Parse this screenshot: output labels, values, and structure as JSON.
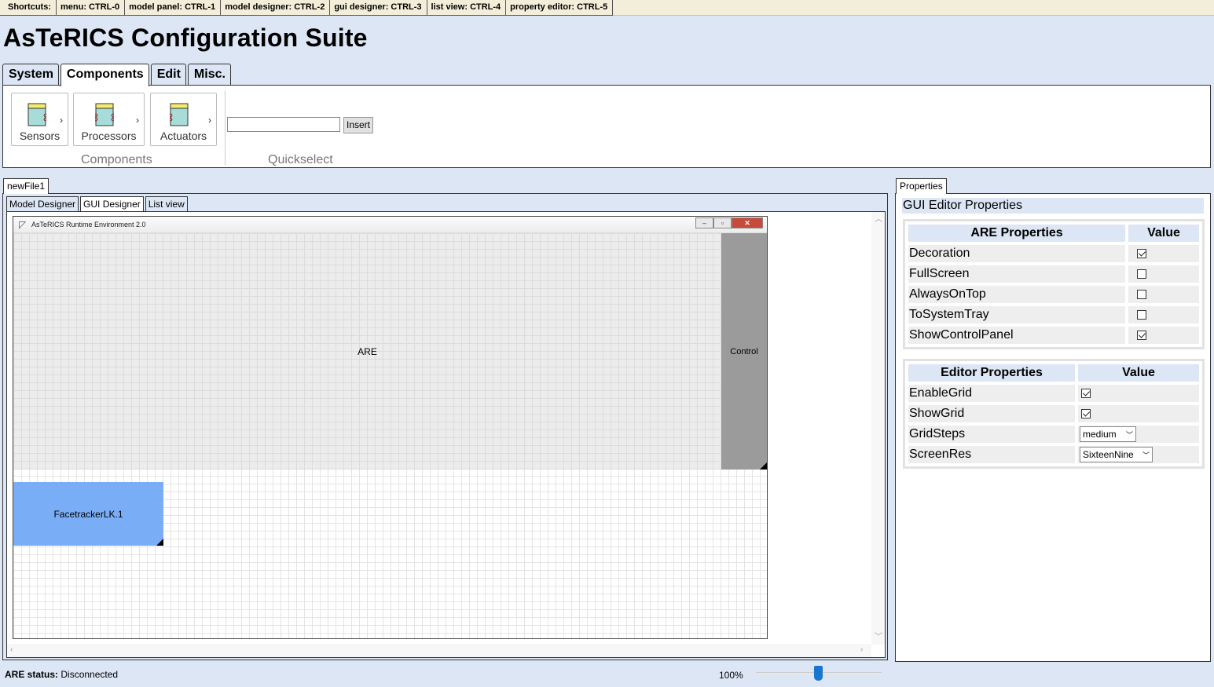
{
  "shortcuts": {
    "label": "Shortcuts:",
    "items": [
      "menu: CTRL-0",
      "model panel: CTRL-1",
      "model designer: CTRL-2",
      "gui designer: CTRL-3",
      "list view: CTRL-4",
      "property editor: CTRL-5"
    ]
  },
  "app": {
    "title": "AsTeRICS Configuration Suite"
  },
  "main_tabs": [
    "System",
    "Components",
    "Edit",
    "Misc."
  ],
  "ribbon": {
    "buttons": [
      {
        "label": "Sensors",
        "icon": "sensor-icon"
      },
      {
        "label": "Processors",
        "icon": "processor-icon"
      },
      {
        "label": "Actuators",
        "icon": "actuator-icon"
      }
    ],
    "components_group": "Components",
    "quickselect_group": "Quickselect",
    "quickselect_value": "",
    "insert_label": "Insert"
  },
  "document": {
    "tab": "newFile1",
    "view_tabs": [
      "Model Designer",
      "GUI Designer",
      "List view"
    ],
    "active_view": "GUI Designer"
  },
  "gui_window": {
    "title": "AsTeRICS Runtime Environment 2.0",
    "are_label": "ARE",
    "control_label": "Control",
    "element_label": "FacetrackerLK.1"
  },
  "properties": {
    "tab": "Properties",
    "header": "GUI Editor Properties",
    "are_table": {
      "col1": "ARE Properties",
      "col2": "Value",
      "rows": [
        {
          "name": "Decoration",
          "checked": true
        },
        {
          "name": "FullScreen",
          "checked": false
        },
        {
          "name": "AlwaysOnTop",
          "checked": false
        },
        {
          "name": "ToSystemTray",
          "checked": false
        },
        {
          "name": "ShowControlPanel",
          "checked": true
        }
      ]
    },
    "editor_table": {
      "col1": "Editor Properties",
      "col2": "Value",
      "enable_grid": {
        "name": "EnableGrid",
        "checked": true
      },
      "show_grid": {
        "name": "ShowGrid",
        "checked": true
      },
      "grid_steps": {
        "name": "GridSteps",
        "value": "medium"
      },
      "screen_res": {
        "name": "ScreenRes",
        "value": "SixteenNine"
      }
    }
  },
  "status": {
    "label": "ARE status:",
    "value": "Disconnected",
    "zoom": "100%",
    "zoom_level": 0.5
  },
  "colors": {
    "background": "#dce6f4",
    "element_fill": "#79aef6",
    "control_fill": "#9b9b9b",
    "zoom_thumb": "#1a75d1"
  }
}
